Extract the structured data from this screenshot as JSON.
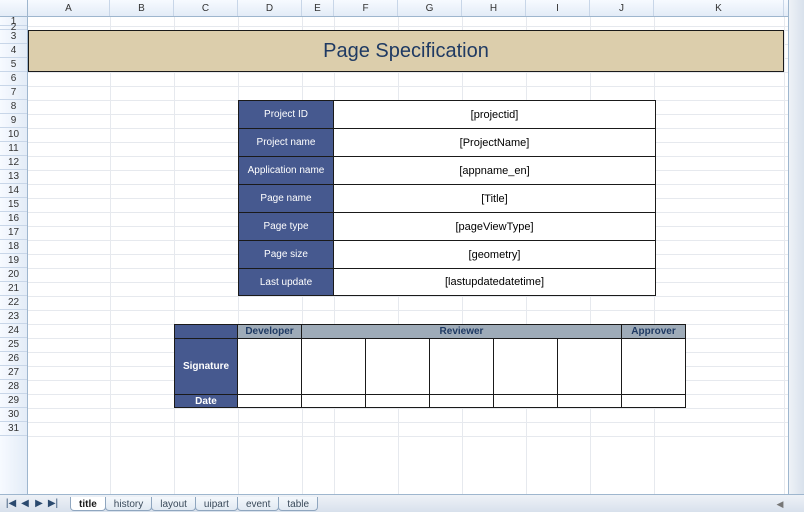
{
  "columns": [
    "A",
    "B",
    "C",
    "D",
    "E",
    "F",
    "G",
    "H",
    "I",
    "J",
    "K"
  ],
  "rows": [
    "1",
    "2",
    "3",
    "4",
    "5",
    "6",
    "7",
    "8",
    "9",
    "10",
    "11",
    "12",
    "13",
    "14",
    "15",
    "16",
    "17",
    "18",
    "19",
    "20",
    "21",
    "22",
    "23",
    "24",
    "25",
    "26",
    "27",
    "28",
    "29",
    "30",
    "31"
  ],
  "title": "Page Specification",
  "spec": [
    {
      "label": "Project ID",
      "value": "[projectid]"
    },
    {
      "label": "Project name",
      "value": "[ProjectName]"
    },
    {
      "label": "Application name",
      "value": "[appname_en]"
    },
    {
      "label": "Page name",
      "value": "[Title]"
    },
    {
      "label": "Page type",
      "value": "[pageViewType]"
    },
    {
      "label": "Page size",
      "value": "[geometry]"
    },
    {
      "label": "Last update",
      "value": "[lastupdatedatetime]"
    }
  ],
  "sig": {
    "headers": {
      "developer": "Developer",
      "reviewer": "Reviewer",
      "approver": "Approver"
    },
    "rows": {
      "signature": "Signature",
      "date": "Date"
    }
  },
  "tabs": [
    "title",
    "history",
    "layout",
    "uipart",
    "event",
    "table"
  ],
  "active_tab": "title",
  "nav": {
    "first": "|◀",
    "prev": "◀",
    "next": "▶",
    "last": "▶|"
  }
}
